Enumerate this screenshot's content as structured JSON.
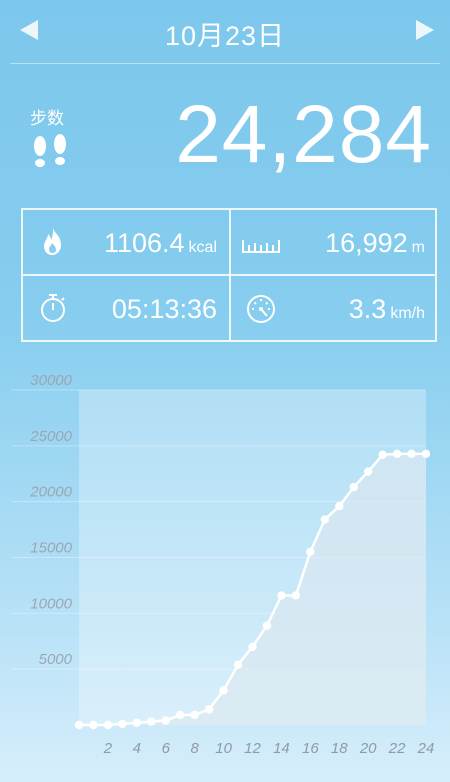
{
  "header": {
    "date": "10月23日"
  },
  "steps": {
    "label": "步数",
    "value": "24,284"
  },
  "stats": {
    "calories": {
      "value": "1106.4",
      "unit": "kcal"
    },
    "distance": {
      "value": "16,992",
      "unit": "m"
    },
    "duration": {
      "value": "05:13:36"
    },
    "speed": {
      "value": "3.3",
      "unit": "km/h"
    }
  },
  "icons": {
    "prev": "chevron-left-icon",
    "next": "chevron-right-icon",
    "steps": "footprints-icon",
    "calories": "flame-icon",
    "distance": "ruler-icon",
    "duration": "stopwatch-icon",
    "speed": "speedometer-icon"
  },
  "colors": {
    "background_top": "#7cc7ec",
    "background_bottom": "#d6eefb",
    "line": "#ffffff",
    "axis_text": "#9aa7b3"
  },
  "chart_data": {
    "type": "line",
    "x": [
      0,
      1,
      2,
      3,
      4,
      5,
      6,
      7,
      8,
      9,
      10,
      11,
      12,
      13,
      14,
      15,
      16,
      17,
      18,
      19,
      20,
      21,
      22,
      23,
      24
    ],
    "values": [
      0,
      0,
      0,
      100,
      200,
      300,
      400,
      900,
      900,
      1400,
      3100,
      5400,
      7000,
      8900,
      11600,
      11600,
      15500,
      18400,
      19600,
      21300,
      22700,
      24200,
      24284,
      24284,
      24284
    ],
    "xticks": [
      "2",
      "4",
      "6",
      "8",
      "10",
      "12",
      "14",
      "16",
      "18",
      "20",
      "22",
      "24"
    ],
    "yticks": [
      "5000",
      "10000",
      "15000",
      "20000",
      "25000",
      "30000"
    ],
    "ylim": [
      0,
      30000
    ],
    "xlim": [
      0,
      24
    ],
    "grid": true
  }
}
